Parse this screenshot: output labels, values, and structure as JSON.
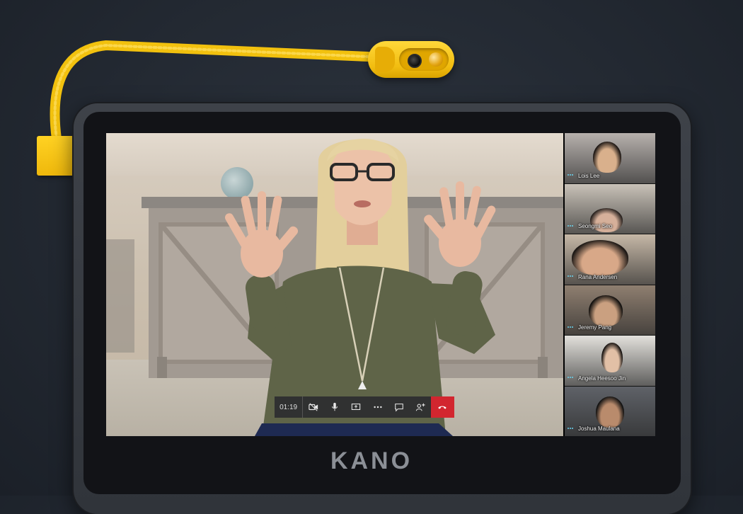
{
  "device": {
    "brand": "KANO"
  },
  "call": {
    "timer": "01:19",
    "controls": [
      {
        "name": "video-toggle-button",
        "icon": "camera-icon"
      },
      {
        "name": "mute-button",
        "icon": "microphone-icon"
      },
      {
        "name": "share-screen-button",
        "icon": "share-screen-icon"
      },
      {
        "name": "more-options-button",
        "icon": "more-dots-icon"
      },
      {
        "name": "chat-button",
        "icon": "chat-icon"
      },
      {
        "name": "add-participant-button",
        "icon": "add-person-icon"
      },
      {
        "name": "hang-up-button",
        "icon": "phone-hangup-icon"
      }
    ],
    "hangup_color": "#d2262f"
  },
  "participants": [
    {
      "name": "Lois Lee",
      "bg": "#b7b1ad",
      "face": "#d9b08c",
      "hair": "#1d1714"
    },
    {
      "name": "Seongmi Seo",
      "bg": "#c9c2b8",
      "face": "#d6b09a",
      "hair": "#2a2320"
    },
    {
      "name": "Rana Andersen",
      "bg": "#c6b8a7",
      "face": "#d8a888",
      "hair": "#1f1a17"
    },
    {
      "name": "Jeremy Pang",
      "bg": "#8f7f70",
      "face": "#caa080",
      "hair": "#141210"
    },
    {
      "name": "Angela Heesoo Jin",
      "bg": "#e3e1dc",
      "face": "#e2c0a6",
      "hair": "#15110f"
    },
    {
      "name": "Joshua Maulana",
      "bg": "#5f6268",
      "face": "#b98b6c",
      "hair": "#121212"
    }
  ]
}
